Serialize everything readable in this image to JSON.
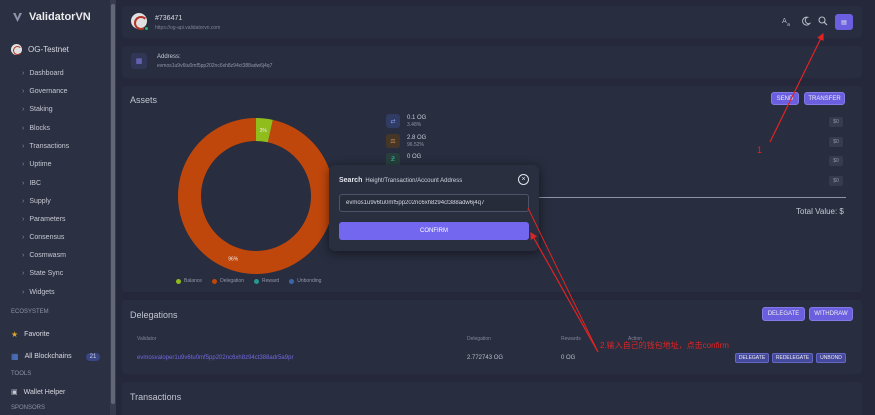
{
  "sidebar": {
    "brand": "ValidatorVN",
    "chain": "OG-Testnet",
    "items": [
      {
        "label": "Dashboard"
      },
      {
        "label": "Governance"
      },
      {
        "label": "Staking"
      },
      {
        "label": "Blocks"
      },
      {
        "label": "Transactions"
      },
      {
        "label": "Uptime"
      },
      {
        "label": "IBC"
      },
      {
        "label": "Supply"
      },
      {
        "label": "Parameters"
      },
      {
        "label": "Consensus"
      },
      {
        "label": "Cosmwasm"
      },
      {
        "label": "State Sync"
      },
      {
        "label": "Widgets"
      }
    ],
    "ecosystem_label": "ECOSYSTEM",
    "favorite": "Favorite",
    "all_blockchains": "All Blockchains",
    "all_blockchains_count": "21",
    "tools_label": "TOOLS",
    "wallet_helper": "Wallet Helper",
    "sponsors_label": "SPONSORS"
  },
  "header": {
    "block_number": "#736471",
    "api_url": "https://og-api.validatorvn.com",
    "wallet_button": "▤",
    "icons": [
      "translate-icon",
      "moon-icon",
      "search-icon",
      "wallet-icon"
    ]
  },
  "address_card": {
    "label": "Address:",
    "value": "evmos1u9v6tu0mf5pp202nc6xh8z94ct388adw6j4q7"
  },
  "assets": {
    "title": "Assets",
    "send_label": "SEND",
    "transfer_label": "TRANSFER",
    "rows": [
      {
        "amount": "0.1 OG",
        "percent": "3.48%",
        "usd": "$0"
      },
      {
        "amount": "2.8 OG",
        "percent": "96.52%",
        "usd": "$0"
      },
      {
        "amount": "0 OG",
        "percent": "",
        "usd": "$0"
      },
      {
        "amount": "",
        "percent": "",
        "usd": "$0"
      }
    ],
    "total_value": "Total Value: $",
    "chart_data": {
      "type": "pie",
      "categories": [
        "Balance",
        "Delegation",
        "Reward",
        "Unbonding"
      ],
      "values": [
        3.48,
        96.52,
        0,
        0
      ],
      "labels": [
        "3%",
        "96%"
      ],
      "colors": [
        "#9ccc1c",
        "#cf4c0b",
        "#26a69a",
        "#3f6fb5"
      ],
      "legend": "bottom"
    }
  },
  "delegations": {
    "title": "Delegations",
    "delegate_label": "DELEGATE",
    "withdraw_label": "WITHDRAW",
    "columns": [
      "Validator",
      "Delegation",
      "Rewards",
      "Action"
    ],
    "row": {
      "validator": "evmosvaloper1u9v6tu0mf5pp202nc6xh8z94ct388adr5a9pr",
      "delegation": "2.772743 OG",
      "rewards": "0 OG",
      "actions": [
        "DELEGATE",
        "REDELEGATE",
        "UNBOND"
      ]
    }
  },
  "transactions": {
    "title": "Transactions"
  },
  "search_modal": {
    "title": "Search",
    "subtitle": "Height/Transaction/Account Address",
    "input_value": "evmos1u9v6tu0mf5pp202nc6xh8z94ct388adw6j4q7",
    "confirm_label": "CONFIRM",
    "close_glyph": "×"
  },
  "annotations": {
    "step1": "1",
    "step2": "2.输入自己的钱包地址，点击confirm",
    "color": "#e02424"
  }
}
